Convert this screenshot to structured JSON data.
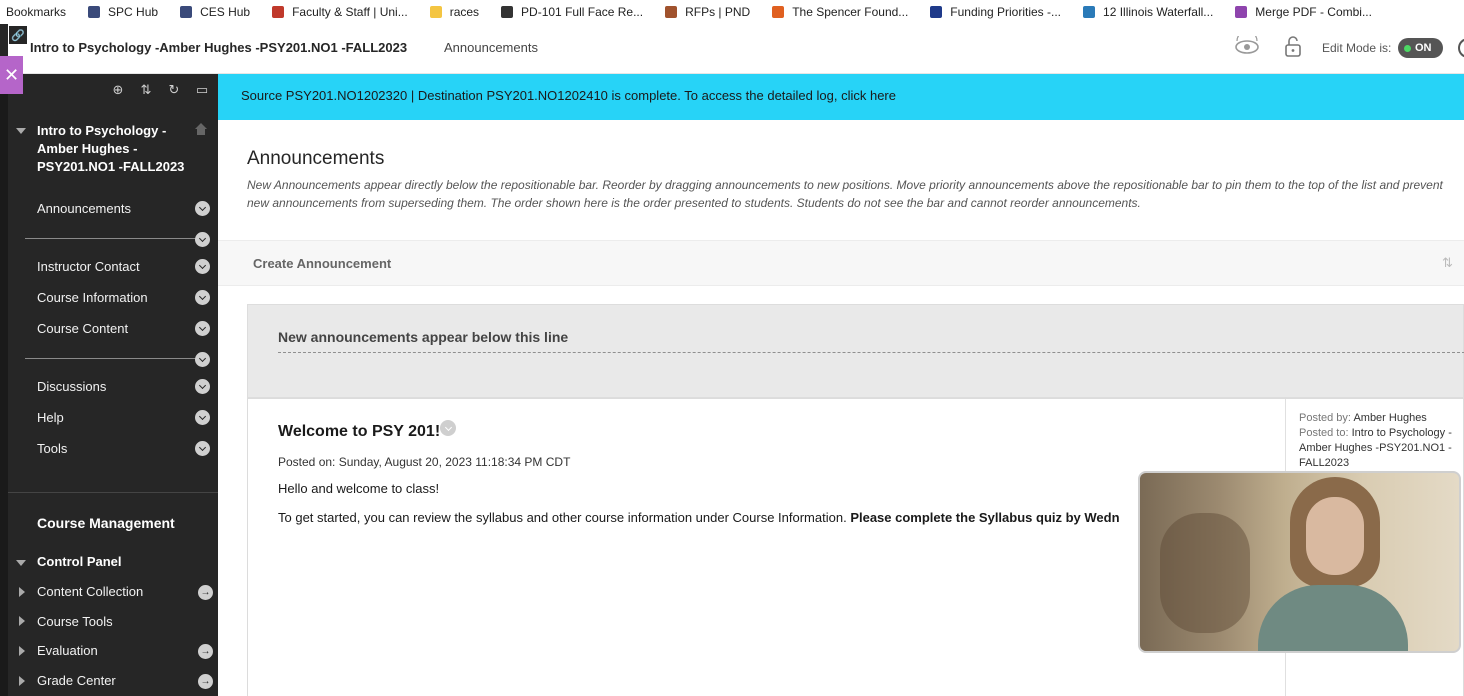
{
  "bookmarks": [
    {
      "label": "Bookmarks",
      "icon": "bookmarks-folder-icon",
      "color": ""
    },
    {
      "label": "SPC Hub",
      "icon": "page-icon",
      "color": "#3a4a7a"
    },
    {
      "label": "CES Hub",
      "icon": "page-icon",
      "color": "#3a4a7a"
    },
    {
      "label": "Faculty & Staff | Uni...",
      "icon": "university-icon",
      "color": "#c0392b"
    },
    {
      "label": "races",
      "icon": "folder-icon",
      "color": "#f4c542"
    },
    {
      "label": "PD-101 Full Face Re...",
      "icon": "play-icon",
      "color": "#333333"
    },
    {
      "label": "RFPs | PND",
      "icon": "pnd-icon",
      "color": "#a0522d"
    },
    {
      "label": "The Spencer Found...",
      "icon": "spencer-icon",
      "color": "#e06020"
    },
    {
      "label": "Funding Priorities -...",
      "icon": "funding-icon",
      "color": "#1f3a8a"
    },
    {
      "label": "12 Illinois Waterfall...",
      "icon": "waterfall-icon",
      "color": "#2a7ab8"
    },
    {
      "label": "Merge PDF - Combi...",
      "icon": "merge-pdf-icon",
      "color": "#8e44ad"
    }
  ],
  "header": {
    "course_title": "Intro to Psychology -Amber Hughes -PSY201.NO1 -FALL2023",
    "page_crumb": "Announcements",
    "edit_mode_label": "Edit Mode is:",
    "edit_mode_state": "ON"
  },
  "sidebar": {
    "course_title": "Intro to Psychology - Amber Hughes - PSY201.NO1 -FALL2023",
    "items": [
      {
        "label": "Announcements"
      },
      {
        "label": "Instructor Contact"
      },
      {
        "label": "Course Information"
      },
      {
        "label": "Course Content"
      },
      {
        "label": "Discussions"
      },
      {
        "label": "Help"
      },
      {
        "label": "Tools"
      }
    ],
    "course_management": "Course Management",
    "control_panel": "Control Panel",
    "cp_items": [
      {
        "label": "Content Collection"
      },
      {
        "label": "Course Tools"
      },
      {
        "label": "Evaluation"
      },
      {
        "label": "Grade Center"
      }
    ]
  },
  "banner": {
    "text": "Source PSY201.NO1202320 | Destination PSY201.NO1202410 is complete. To access the detailed log, click here"
  },
  "main": {
    "title": "Announcements",
    "description": "New Announcements appear directly below the repositionable bar. Reorder by dragging announcements to new positions. Move priority announcements above the repositionable bar to pin them to the top of the list and prevent new announcements from superseding them. The order shown here is the order presented to students. Students do not see the bar and cannot reorder announcements.",
    "create_button": "Create Announcement",
    "repositionable_bar": "New announcements appear below this line"
  },
  "announcement": {
    "title": "Welcome to PSY 201!",
    "posted_on": "Posted on: Sunday, August 20, 2023 11:18:34 PM CDT",
    "body1": "Hello and welcome to class!",
    "body2_plain": "To get started, you can review the syllabus and other course information under Course Information. ",
    "body2_bold": "Please complete the Syllabus quiz by Wedn",
    "posted_by_label": "Posted by:",
    "posted_by": "Amber Hughes",
    "posted_to_label": "Posted to:",
    "posted_to": "Intro to Psychology -Amber Hughes -PSY201.NO1 -FALL2023"
  },
  "colors": {
    "banner": "#27d3f7",
    "sidebar": "#262626",
    "close_tab": "#b565c9",
    "toggle_on": "#4cd964"
  }
}
